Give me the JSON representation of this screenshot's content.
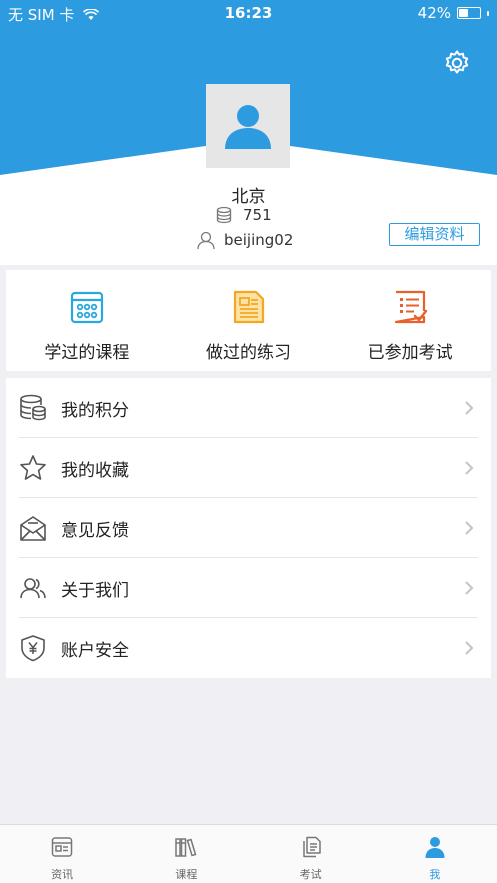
{
  "status_bar": {
    "carrier": "无 SIM 卡",
    "time": "16:23",
    "battery": "42%",
    "battery_level": 0.42
  },
  "colors": {
    "brand_blue": "#2d9be0",
    "orange": "#f5a623",
    "red_orange": "#e8602c",
    "avatar_bg": "#e6e6e6"
  },
  "header": {
    "settings_icon": "gear-icon"
  },
  "profile": {
    "name": "北京",
    "points": "751",
    "username": "beijing02",
    "edit_label": "编辑资料"
  },
  "quick_actions": [
    {
      "label": "学过的课程",
      "icon": "calendar-icon"
    },
    {
      "label": "做过的练习",
      "icon": "document-icon"
    },
    {
      "label": "已参加考试",
      "icon": "checklist-icon"
    }
  ],
  "menu": [
    {
      "label": "我的积分",
      "icon": "coins-icon"
    },
    {
      "label": "我的收藏",
      "icon": "star-icon"
    },
    {
      "label": "意见反馈",
      "icon": "feedback-mail-icon"
    },
    {
      "label": "关于我们",
      "icon": "people-icon"
    },
    {
      "label": "账户安全",
      "icon": "shield-yen-icon"
    }
  ],
  "tabs": [
    {
      "label": "资讯",
      "icon": "news-icon",
      "active": false
    },
    {
      "label": "课程",
      "icon": "books-icon",
      "active": false
    },
    {
      "label": "考试",
      "icon": "exam-icon",
      "active": false
    },
    {
      "label": "我",
      "icon": "person-icon",
      "active": true
    }
  ]
}
